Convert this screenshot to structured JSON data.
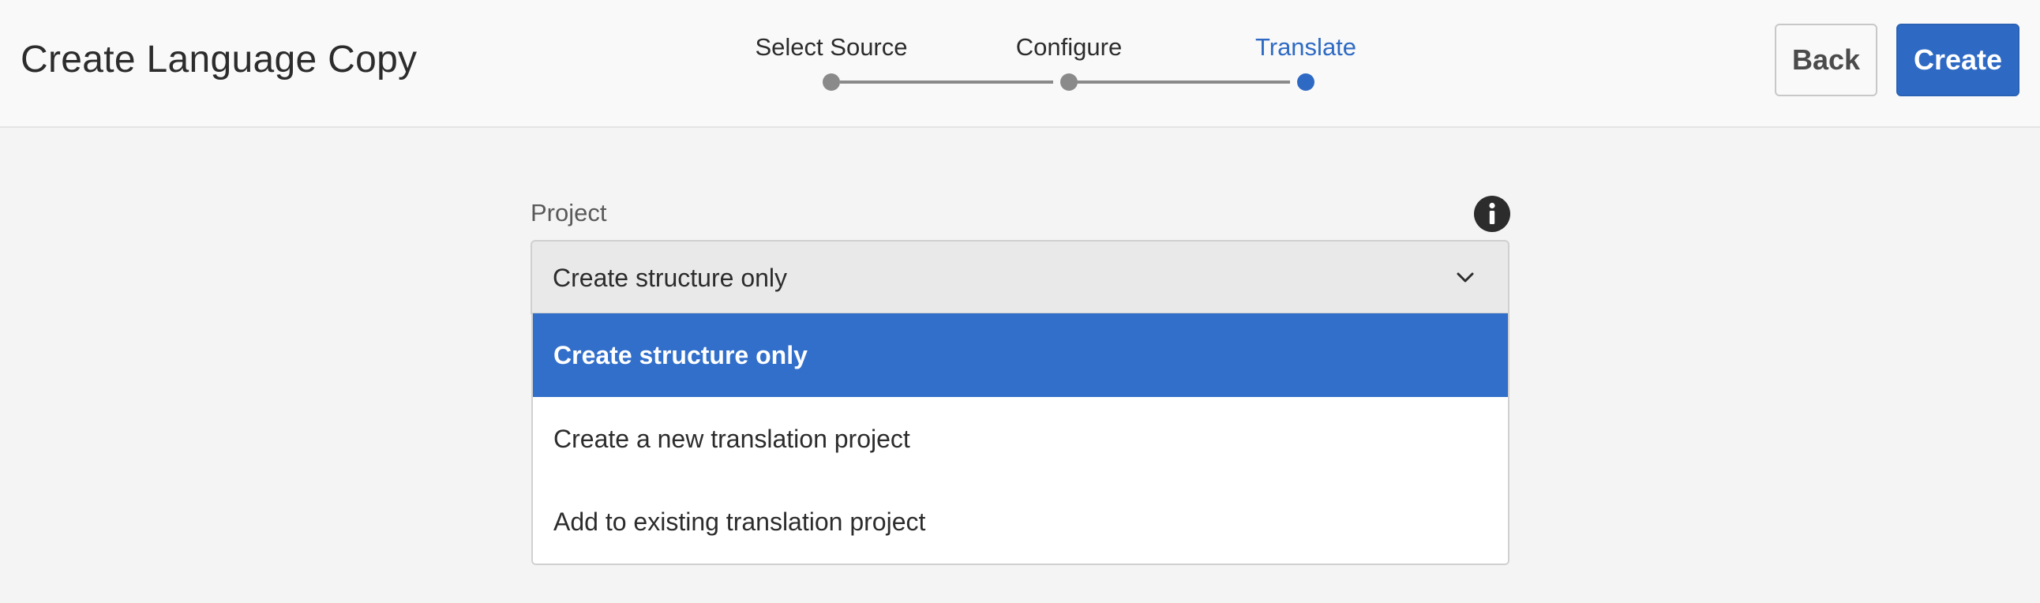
{
  "header": {
    "title": "Create Language Copy",
    "back_label": "Back",
    "create_label": "Create"
  },
  "wizard": {
    "steps": [
      {
        "label": "Select Source",
        "state": "completed"
      },
      {
        "label": "Configure",
        "state": "completed"
      },
      {
        "label": "Translate",
        "state": "current"
      }
    ]
  },
  "form": {
    "project_label": "Project",
    "info_icon": "info-icon",
    "project_select": {
      "value": "Create structure only",
      "expanded": true,
      "options": [
        {
          "label": "Create structure only",
          "selected": true
        },
        {
          "label": "Create a new translation project",
          "selected": false
        },
        {
          "label": "Add to existing translation project",
          "selected": false
        }
      ]
    }
  },
  "colors": {
    "accent": "#2e6ac4",
    "selected_option": "#326fca",
    "inactive_step": "#8a8a8a"
  }
}
